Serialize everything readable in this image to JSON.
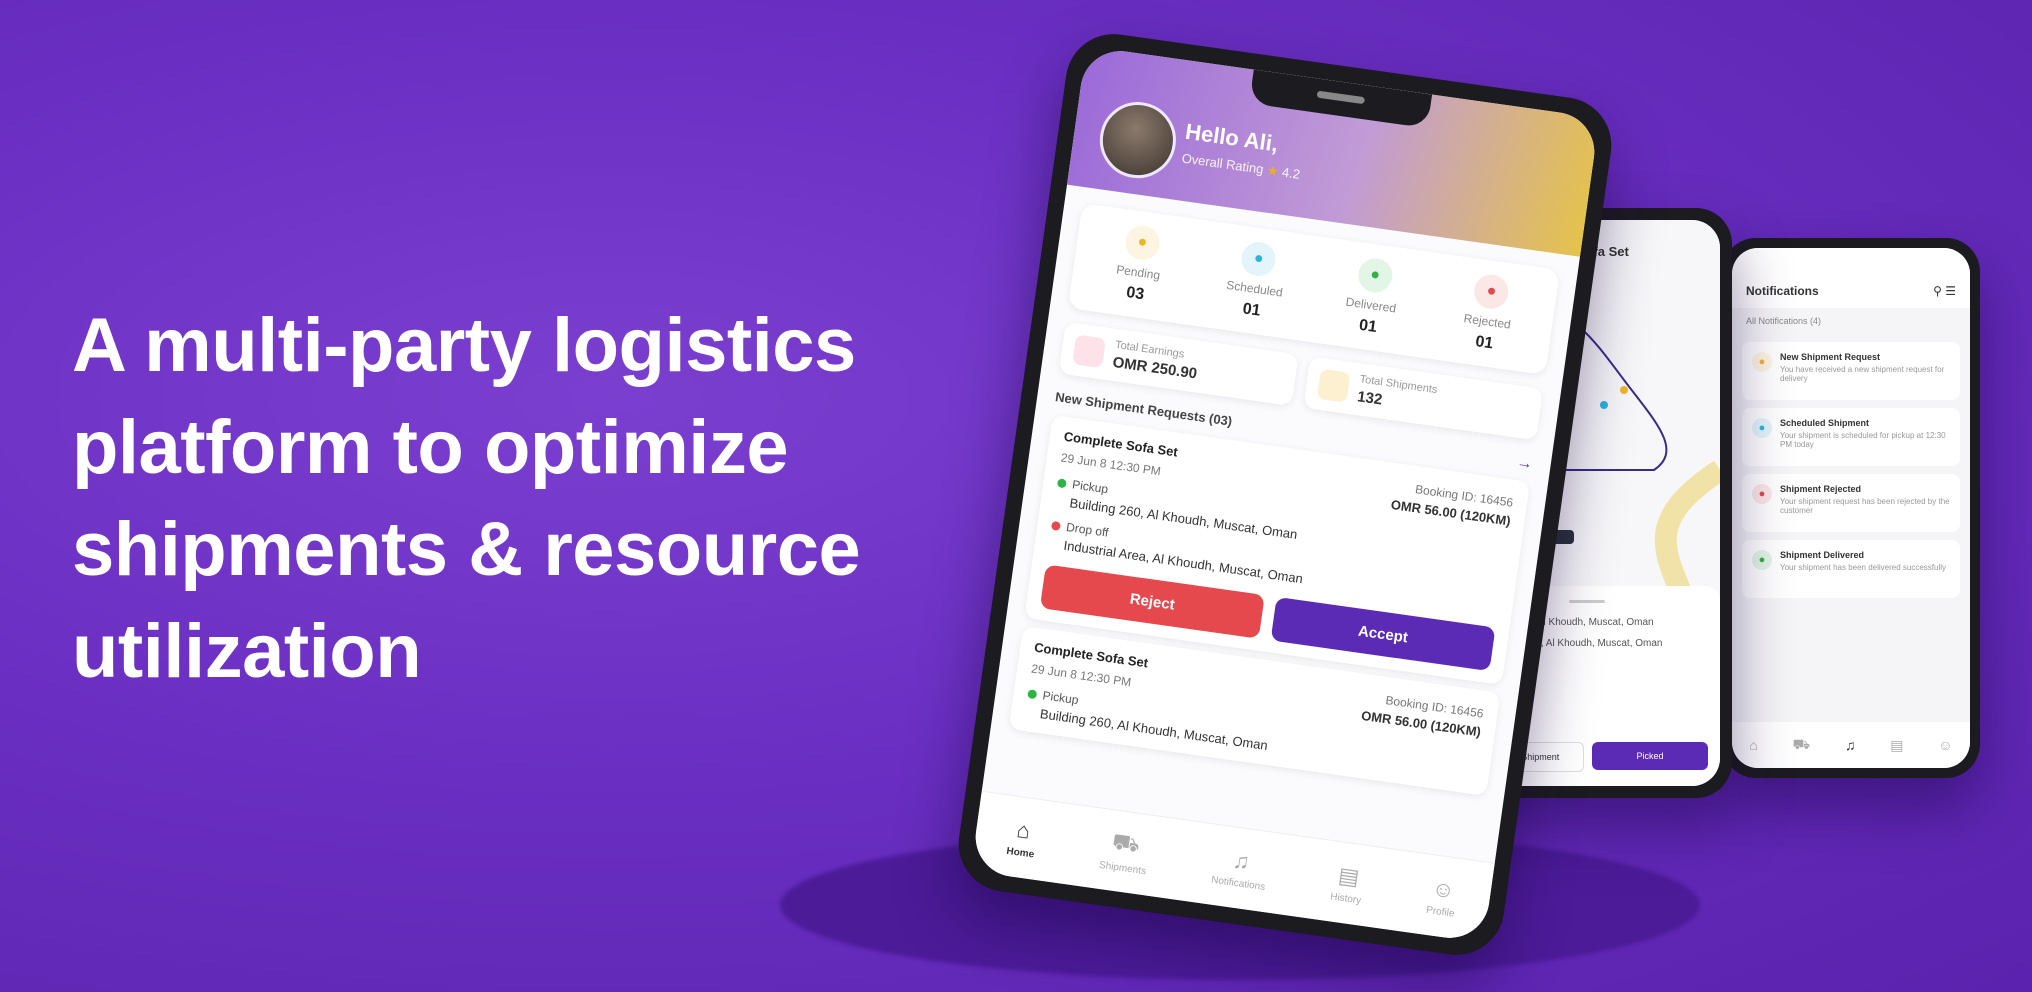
{
  "headline": "A multi-party logistics\nplatform to optimize\nshipments & resource\nutilization",
  "main_phone": {
    "greeting": "Hello Ali,",
    "rating_label": "Overall Rating",
    "rating_value": "4.2",
    "stats": [
      {
        "label": "Pending",
        "value": "03",
        "icon": "box-icon",
        "color": "#f0b429"
      },
      {
        "label": "Scheduled",
        "value": "01",
        "icon": "calendar-icon",
        "color": "#2bb3e0"
      },
      {
        "label": "Delivered",
        "value": "01",
        "icon": "truck-icon",
        "color": "#2fb344"
      },
      {
        "label": "Rejected",
        "value": "01",
        "icon": "cancel-icon",
        "color": "#e5484d"
      }
    ],
    "earnings": {
      "label": "Total Earnings",
      "value": "OMR 250.90"
    },
    "shipments": {
      "label": "Total Shipments",
      "value": "132"
    },
    "section_title": "New Shipment Requests (03)",
    "requests": [
      {
        "title": "Complete Sofa Set",
        "datetime": "29 Jun 8 12:30 PM",
        "booking": "Booking ID: 16456",
        "price": "OMR 56.00 (120KM)",
        "pickup_label": "Pickup",
        "pickup": "Building 260, Al Khoudh, Muscat, Oman",
        "drop_label": "Drop off",
        "drop": "Industrial Area, Al Khoudh, Muscat, Oman"
      },
      {
        "title": "Complete Sofa Set",
        "datetime": "29 Jun 8 12:30 PM",
        "booking": "Booking ID: 16456",
        "price": "OMR 56.00 (120KM)",
        "pickup_label": "Pickup",
        "pickup": "Building 260, Al Khoudh, Muscat, Oman"
      }
    ],
    "reject_label": "Reject",
    "accept_label": "Accept",
    "tabs": [
      "Home",
      "Shipments",
      "Notifications",
      "History",
      "Profile"
    ]
  },
  "map_phone": {
    "title": "Complete Sofa Set",
    "pickup": "Building 260, Al Khoudh, Muscat, Oman",
    "drop": "Industrial Area, Al Khoudh, Muscat, Oman",
    "cancel_label": "Cancel Shipment",
    "pickup_button": "Picked"
  },
  "notif_phone": {
    "title": "Notifications",
    "subtitle": "All Notifications (4)",
    "items": [
      {
        "title": "New Shipment Request",
        "body": "You have received a new shipment request for delivery",
        "color": "#f0b429",
        "icon": "box-icon"
      },
      {
        "title": "Scheduled Shipment",
        "body": "Your shipment is scheduled for pickup at 12:30 PM today",
        "color": "#2bb3e0",
        "icon": "calendar-icon"
      },
      {
        "title": "Shipment Rejected",
        "body": "Your shipment request has been rejected by the customer",
        "color": "#e5484d",
        "icon": "cancel-icon"
      },
      {
        "title": "Shipment Delivered",
        "body": "Your shipment has been delivered successfully",
        "color": "#2fb344",
        "icon": "truck-icon"
      }
    ]
  }
}
